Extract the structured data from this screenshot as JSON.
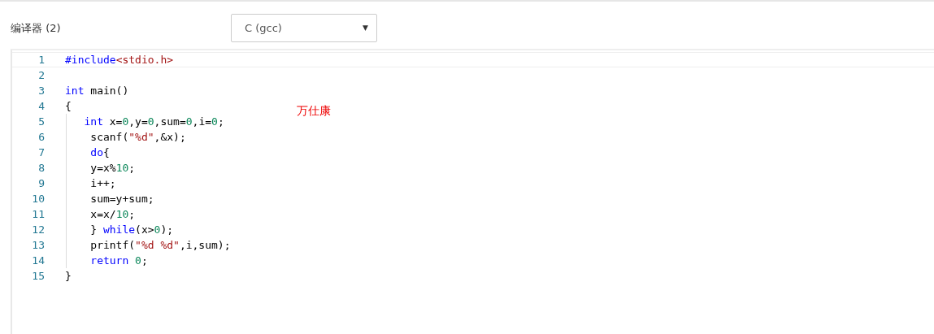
{
  "compiler": {
    "label": "编译器 (2)",
    "select_value": "C (gcc)",
    "caret": "▼"
  },
  "annotation": "万仕康",
  "editor": {
    "lines": [
      {
        "number": "1",
        "active": true,
        "tokens": [
          {
            "kind": "meta",
            "text": "#include"
          },
          {
            "kind": "string",
            "text": "<stdio.h>"
          }
        ]
      },
      {
        "number": "2",
        "active": false
      },
      {
        "number": "3",
        "active": false,
        "tokens": [
          {
            "kind": "keyword",
            "text": "int"
          },
          {
            "kind": "plain",
            "text": " main()"
          }
        ]
      },
      {
        "number": "4",
        "active": false,
        "tokens": [
          {
            "kind": "plain",
            "text": "{"
          }
        ]
      },
      {
        "number": "5",
        "active": false,
        "tokens": [
          {
            "kind": "keyword",
            "text": "   int"
          },
          {
            "kind": "plain",
            "text": " x="
          },
          {
            "kind": "number",
            "text": "0"
          },
          {
            "kind": "plain",
            "text": ",y="
          },
          {
            "kind": "number",
            "text": "0"
          },
          {
            "kind": "plain",
            "text": ",sum="
          },
          {
            "kind": "number",
            "text": "0"
          },
          {
            "kind": "plain",
            "text": ",i="
          },
          {
            "kind": "number",
            "text": "0"
          },
          {
            "kind": "plain",
            "text": ";"
          }
        ]
      },
      {
        "number": "6",
        "active": false,
        "tokens": [
          {
            "kind": "plain",
            "text": "    scanf("
          },
          {
            "kind": "string",
            "text": "\"%d\""
          },
          {
            "kind": "plain",
            "text": ",&x);"
          }
        ]
      },
      {
        "number": "7",
        "active": false,
        "tokens": [
          {
            "kind": "keyword",
            "text": "    do"
          },
          {
            "kind": "plain",
            "text": "{"
          }
        ]
      },
      {
        "number": "8",
        "active": false,
        "tokens": [
          {
            "kind": "plain",
            "text": "    y=x%"
          },
          {
            "kind": "number",
            "text": "10"
          },
          {
            "kind": "plain",
            "text": ";"
          }
        ]
      },
      {
        "number": "9",
        "active": false,
        "tokens": [
          {
            "kind": "plain",
            "text": "    i++;"
          }
        ]
      },
      {
        "number": "10",
        "active": false,
        "tokens": [
          {
            "kind": "plain",
            "text": "    sum=y+sum;"
          }
        ]
      },
      {
        "number": "11",
        "active": false,
        "tokens": [
          {
            "kind": "plain",
            "text": "    x=x/"
          },
          {
            "kind": "number",
            "text": "10"
          },
          {
            "kind": "plain",
            "text": ";"
          }
        ]
      },
      {
        "number": "12",
        "active": false,
        "tokens": [
          {
            "kind": "plain",
            "text": "    } "
          },
          {
            "kind": "keyword",
            "text": "while"
          },
          {
            "kind": "plain",
            "text": "(x>"
          },
          {
            "kind": "number",
            "text": "0"
          },
          {
            "kind": "plain",
            "text": ");"
          }
        ]
      },
      {
        "number": "13",
        "active": false,
        "tokens": [
          {
            "kind": "plain",
            "text": "    printf("
          },
          {
            "kind": "string",
            "text": "\"%d %d\""
          },
          {
            "kind": "plain",
            "text": ",i,sum);"
          }
        ]
      },
      {
        "number": "14",
        "active": false,
        "tokens": [
          {
            "kind": "keyword",
            "text": "    return"
          },
          {
            "kind": "number",
            "text": " 0"
          },
          {
            "kind": "plain",
            "text": ";"
          }
        ]
      },
      {
        "number": "15",
        "active": false,
        "tokens": [
          {
            "kind": "plain",
            "text": "}"
          }
        ]
      }
    ]
  }
}
